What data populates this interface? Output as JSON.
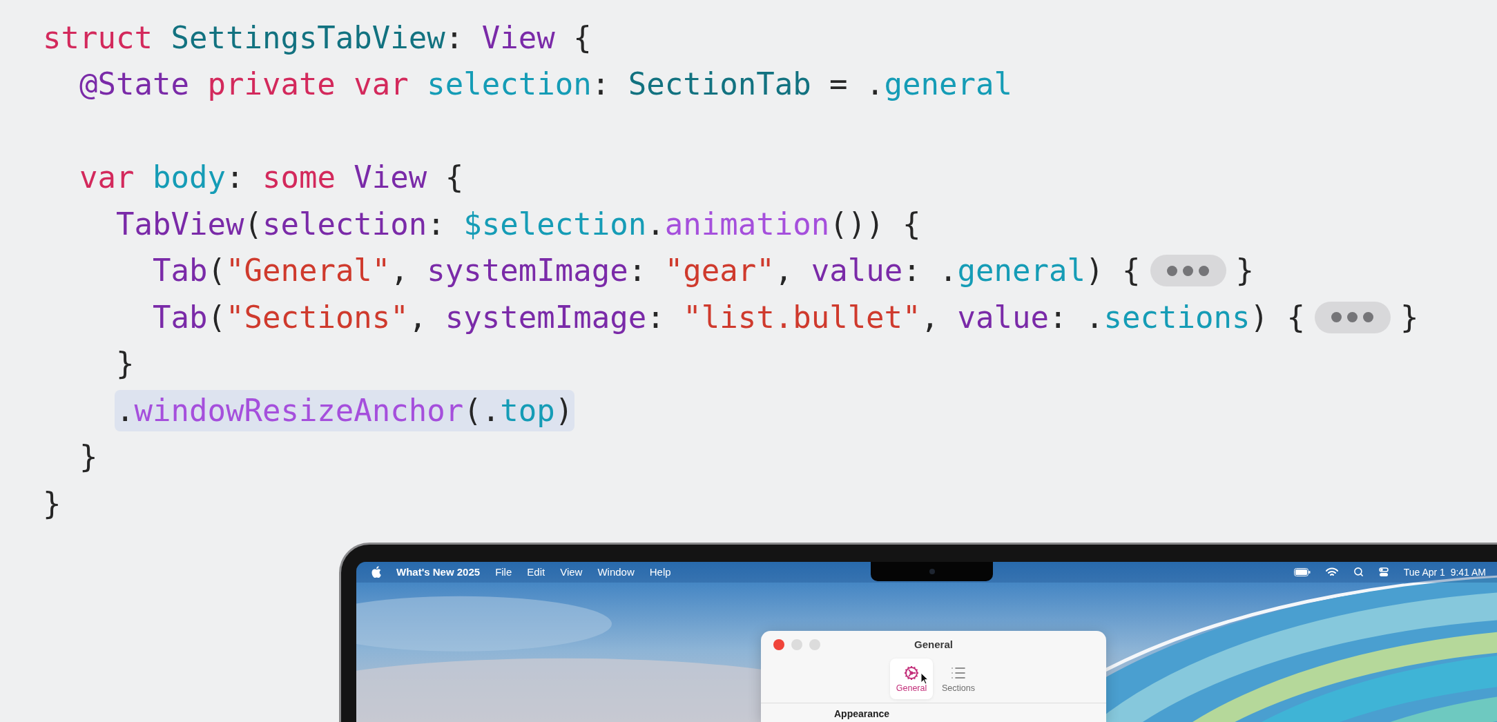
{
  "code_lines": [
    {
      "kind": "code",
      "highlighted": false,
      "tokens": [
        {
          "kind": "kw",
          "text": "struct"
        },
        {
          "kind": "type",
          "text": " SettingsTabView"
        },
        {
          "kind": "plain",
          "text": ": "
        },
        {
          "kind": "sys",
          "text": "View"
        },
        {
          "kind": "plain",
          "text": " {"
        }
      ]
    },
    {
      "kind": "code",
      "highlighted": false,
      "tokens": [
        {
          "kind": "sys",
          "text": "  @State"
        },
        {
          "kind": "kw",
          "text": " private"
        },
        {
          "kind": "kw",
          "text": " var"
        },
        {
          "kind": "ident",
          "text": " selection"
        },
        {
          "kind": "plain",
          "text": ": "
        },
        {
          "kind": "type",
          "text": "SectionTab"
        },
        {
          "kind": "plain",
          "text": " = ."
        },
        {
          "kind": "ident",
          "text": "general"
        }
      ]
    },
    {
      "kind": "blank"
    },
    {
      "kind": "code",
      "highlighted": false,
      "tokens": [
        {
          "kind": "kw",
          "text": "  var"
        },
        {
          "kind": "ident",
          "text": " body"
        },
        {
          "kind": "plain",
          "text": ": "
        },
        {
          "kind": "kw",
          "text": "some"
        },
        {
          "kind": "sys",
          "text": " View"
        },
        {
          "kind": "plain",
          "text": " {"
        }
      ]
    },
    {
      "kind": "code",
      "highlighted": false,
      "tokens": [
        {
          "kind": "sys",
          "text": "    TabView"
        },
        {
          "kind": "plain",
          "text": "("
        },
        {
          "kind": "sys",
          "text": "selection"
        },
        {
          "kind": "plain",
          "text": ": "
        },
        {
          "kind": "ident",
          "text": "$selection"
        },
        {
          "kind": "plain",
          "text": "."
        },
        {
          "kind": "method",
          "text": "animation"
        },
        {
          "kind": "plain",
          "text": "()) {"
        }
      ]
    },
    {
      "kind": "code",
      "highlighted": false,
      "tokens": [
        {
          "kind": "sys",
          "text": "      Tab"
        },
        {
          "kind": "plain",
          "text": "("
        },
        {
          "kind": "str",
          "text": "\"General\""
        },
        {
          "kind": "plain",
          "text": ", "
        },
        {
          "kind": "sys",
          "text": "systemImage"
        },
        {
          "kind": "plain",
          "text": ": "
        },
        {
          "kind": "str",
          "text": "\"gear\""
        },
        {
          "kind": "plain",
          "text": ", "
        },
        {
          "kind": "sys",
          "text": "value"
        },
        {
          "kind": "plain",
          "text": ": ."
        },
        {
          "kind": "ident",
          "text": "general"
        },
        {
          "kind": "plain",
          "text": ") {"
        },
        {
          "kind": "fold"
        },
        {
          "kind": "plain",
          "text": "}"
        }
      ]
    },
    {
      "kind": "code",
      "highlighted": false,
      "tokens": [
        {
          "kind": "sys",
          "text": "      Tab"
        },
        {
          "kind": "plain",
          "text": "("
        },
        {
          "kind": "str",
          "text": "\"Sections\""
        },
        {
          "kind": "plain",
          "text": ", "
        },
        {
          "kind": "sys",
          "text": "systemImage"
        },
        {
          "kind": "plain",
          "text": ": "
        },
        {
          "kind": "str",
          "text": "\"list.bullet\""
        },
        {
          "kind": "plain",
          "text": ", "
        },
        {
          "kind": "sys",
          "text": "value"
        },
        {
          "kind": "plain",
          "text": ": ."
        },
        {
          "kind": "ident",
          "text": "sections"
        },
        {
          "kind": "plain",
          "text": ") {"
        },
        {
          "kind": "fold"
        },
        {
          "kind": "plain",
          "text": "}"
        }
      ]
    },
    {
      "kind": "code",
      "highlighted": false,
      "tokens": [
        {
          "kind": "plain",
          "text": "    }"
        }
      ]
    },
    {
      "kind": "code",
      "highlighted": true,
      "tokens": [
        {
          "kind": "plain",
          "text": "    ."
        },
        {
          "kind": "method",
          "text": "windowResizeAnchor"
        },
        {
          "kind": "plain",
          "text": "(."
        },
        {
          "kind": "ident",
          "text": "top"
        },
        {
          "kind": "plain",
          "text": ")"
        }
      ]
    },
    {
      "kind": "code",
      "highlighted": false,
      "tokens": [
        {
          "kind": "plain",
          "text": "  }"
        }
      ]
    },
    {
      "kind": "code",
      "highlighted": false,
      "tokens": [
        {
          "kind": "plain",
          "text": "}"
        }
      ]
    }
  ],
  "menu_bar": {
    "app_name": "What's New 2025",
    "menus": [
      "File",
      "Edit",
      "View",
      "Window",
      "Help"
    ],
    "clock": "Tue Apr 1  9:41 AM"
  },
  "window": {
    "title": "General",
    "tabs": [
      {
        "label": "General",
        "selected": true
      },
      {
        "label": "Sections",
        "selected": false
      }
    ],
    "section_heading": "Appearance"
  }
}
